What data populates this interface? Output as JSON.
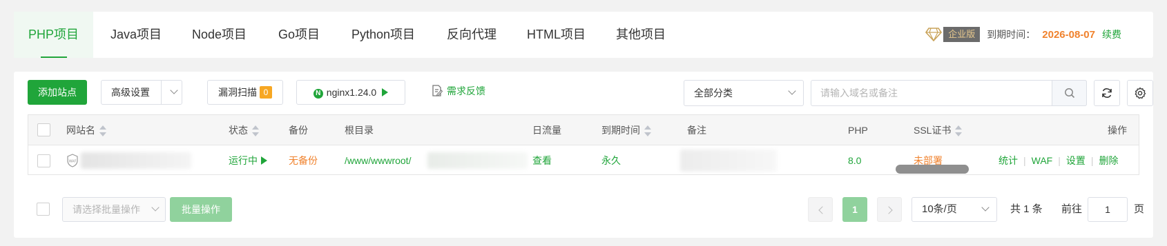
{
  "tabs": [
    {
      "label": "PHP项目",
      "active": true
    },
    {
      "label": "Java项目"
    },
    {
      "label": "Node项目"
    },
    {
      "label": "Go项目"
    },
    {
      "label": "Python项目"
    },
    {
      "label": "反向代理"
    },
    {
      "label": "HTML项目"
    },
    {
      "label": "其他项目"
    }
  ],
  "expiry": {
    "edition_badge": "企业版",
    "label": "到期时间：",
    "date": "2026-08-07",
    "renew": "续费"
  },
  "toolbar": {
    "add_site": "添加站点",
    "advanced_settings": "高级设置",
    "vuln_scan": "漏洞扫描",
    "vuln_count": "0",
    "nginx_version": "nginx1.24.0",
    "feedback": "需求反馈",
    "category_select": "全部分类",
    "search_placeholder": "请输入域名或备注"
  },
  "table": {
    "headers": {
      "site_name": "网站名",
      "status": "状态",
      "backup": "备份",
      "root_dir": "根目录",
      "daily_traffic": "日流量",
      "expire_time": "到期时间",
      "remark": "备注",
      "php": "PHP",
      "ssl": "SSL证书",
      "actions": "操作"
    },
    "rows": [
      {
        "status": "运行中",
        "backup": "无备份",
        "root_dir": "/www/wwwroot/",
        "traffic": "查看",
        "expire": "永久",
        "php": "8.0",
        "ssl": "未部署",
        "actions": [
          "统计",
          "WAF",
          "设置",
          "删除"
        ]
      }
    ]
  },
  "footer": {
    "batch_placeholder": "请选择批量操作",
    "batch_button": "批量操作",
    "current_page": "1",
    "page_size": "10条/页",
    "total": "共 1 条",
    "goto_label": "前往",
    "goto_value": "1",
    "page_unit": "页"
  },
  "colors": {
    "brand_green": "#20a53a",
    "expiry_orange": "#f0822d",
    "badge_orange": "#f7a723"
  }
}
